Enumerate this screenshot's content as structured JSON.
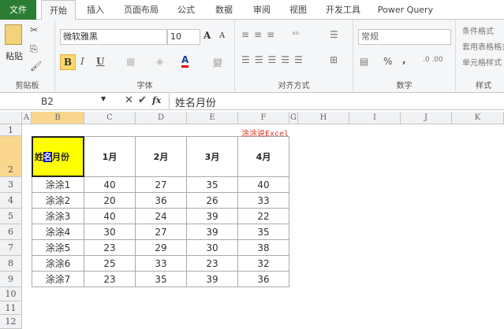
{
  "tabs": [
    "文件",
    "开始",
    "插入",
    "页面布局",
    "公式",
    "数据",
    "审阅",
    "视图",
    "开发工具",
    "Power Query"
  ],
  "ribbon": {
    "clipboard": {
      "label": "剪贴板",
      "paste": "粘贴"
    },
    "font": {
      "label": "字体",
      "name": "微软雅黑",
      "size": "10",
      "bold": "B",
      "italic": "I",
      "underline": "U",
      "font_color_glyph": "A",
      "grow": "A",
      "shrink": "A",
      "wen": "變"
    },
    "alignment": {
      "label": "对齐方式"
    },
    "number": {
      "label": "数字",
      "format": "常规",
      "percent": "%",
      "comma": ","
    },
    "styles": {
      "label": "样式",
      "items": [
        "条件格式",
        "套用表格格式",
        "单元格样式"
      ]
    }
  },
  "formula_bar": {
    "name_box": "B2",
    "fx": "fx",
    "value": "姓名月份"
  },
  "columns": [
    "A",
    "B",
    "C",
    "D",
    "E",
    "F",
    "G",
    "H",
    "I",
    "J",
    "K"
  ],
  "rows": [
    "1",
    "2",
    "3",
    "4",
    "5",
    "6",
    "7",
    "8",
    "9",
    "10",
    "11",
    "12"
  ],
  "watermark": "涂涂说Excel",
  "table": {
    "header": [
      "姓名月份",
      "1月",
      "2月",
      "3月",
      "4月"
    ],
    "rows": [
      [
        "涂涂1",
        "40",
        "27",
        "35",
        "40"
      ],
      [
        "涂涂2",
        "20",
        "36",
        "26",
        "33"
      ],
      [
        "涂涂3",
        "40",
        "24",
        "39",
        "22"
      ],
      [
        "涂涂4",
        "30",
        "27",
        "39",
        "35"
      ],
      [
        "涂涂5",
        "23",
        "29",
        "30",
        "38"
      ],
      [
        "涂涂6",
        "25",
        "33",
        "23",
        "32"
      ],
      [
        "涂涂7",
        "23",
        "35",
        "39",
        "36"
      ]
    ]
  },
  "colors": {
    "file_tab": "#2a7d33",
    "selected_cell": "#ffff00",
    "highlight": "#0000cc",
    "watermark": "#e03020"
  }
}
